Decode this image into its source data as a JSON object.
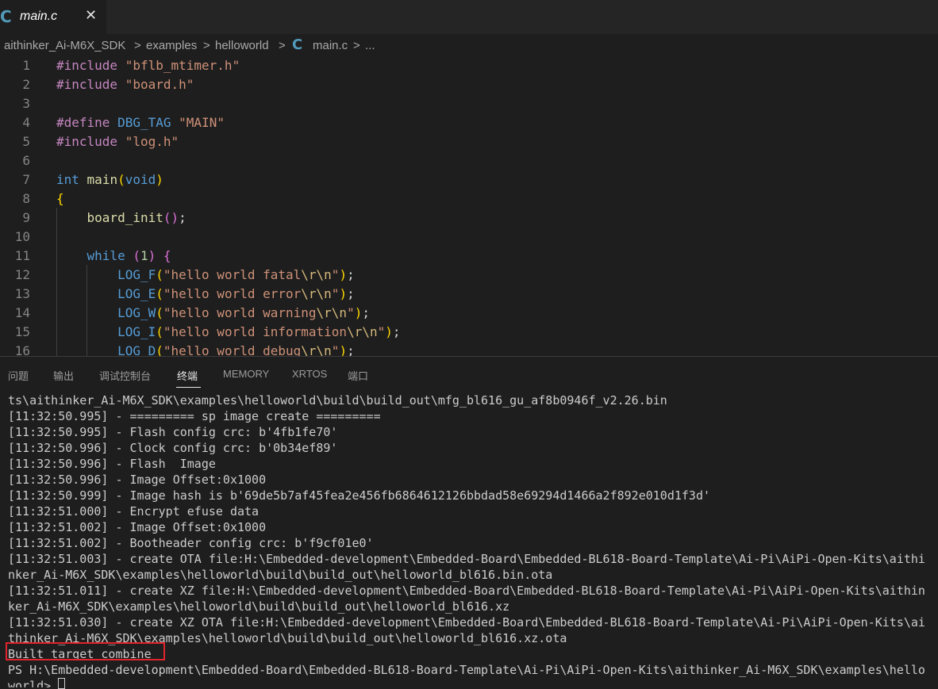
{
  "editor_tab": {
    "icon": "C",
    "label": "main.c",
    "close": "✕"
  },
  "breadcrumb": {
    "items": [
      "aithinker_Ai-M6X_SDK",
      "examples",
      "helloworld",
      "main.c",
      "..."
    ],
    "separator": ">"
  },
  "code": {
    "line_numbers": [
      "1",
      "2",
      "3",
      "4",
      "5",
      "6",
      "7",
      "8",
      "9",
      "10",
      "11",
      "12",
      "13",
      "14",
      "15",
      "16"
    ],
    "lines": [
      "#include \"bflb_mtimer.h\"",
      "#include \"board.h\"",
      "",
      "#define DBG_TAG \"MAIN\"",
      "#include \"log.h\"",
      "",
      "int main(void)",
      "{",
      "    board_init();",
      "",
      "    while (1) {",
      "        LOG_F(\"hello world fatal\\r\\n\");",
      "        LOG_E(\"hello world error\\r\\n\");",
      "        LOG_W(\"hello world warning\\r\\n\");",
      "        LOG_I(\"hello world information\\r\\n\");",
      "        LOG_D(\"hello world debug\\r\\n\");"
    ]
  },
  "panel": {
    "tabs": [
      "问题",
      "输出",
      "调试控制台",
      "终端",
      "MEMORY",
      "XRTOS",
      "端口"
    ],
    "active_tab": "终端"
  },
  "terminal": {
    "lines": [
      "ts\\aithinker_Ai-M6X_SDK\\examples\\helloworld\\build\\build_out\\mfg_bl616_gu_af8b0946f_v2.26.bin",
      "[11:32:50.995] - ========= sp image create =========",
      "[11:32:50.995] - Flash config crc: b'4fb1fe70'",
      "[11:32:50.996] - Clock config crc: b'0b34ef89'",
      "[11:32:50.996] - Flash  Image",
      "[11:32:50.996] - Image Offset:0x1000",
      "[11:32:50.999] - Image hash is b'69de5b7af45fea2e456fb6864612126bbdad58e69294d1466a2f892e010d1f3d'",
      "[11:32:51.000] - Encrypt efuse data",
      "[11:32:51.002] - Image Offset:0x1000",
      "[11:32:51.002] - Bootheader config crc: b'f9cf01e0'",
      "[11:32:51.003] - create OTA file:H:\\Embedded-development\\Embedded-Board\\Embedded-BL618-Board-Template\\Ai-Pi\\AiPi-Open-Kits\\aithi",
      "nker_Ai-M6X_SDK\\examples\\helloworld\\build\\build_out\\helloworld_bl616.bin.ota",
      "[11:32:51.011] - create XZ file:H:\\Embedded-development\\Embedded-Board\\Embedded-BL618-Board-Template\\Ai-Pi\\AiPi-Open-Kits\\aithin",
      "ker_Ai-M6X_SDK\\examples\\helloworld\\build\\build_out\\helloworld_bl616.xz",
      "[11:32:51.030] - create XZ OTA file:H:\\Embedded-development\\Embedded-Board\\Embedded-BL618-Board-Template\\Ai-Pi\\AiPi-Open-Kits\\ai",
      "thinker_Ai-M6X_SDK\\examples\\helloworld\\build\\build_out\\helloworld_bl616.xz.ota",
      "Built target combine",
      "PS H:\\Embedded-development\\Embedded-Board\\Embedded-BL618-Board-Template\\Ai-Pi\\AiPi-Open-Kits\\aithinker_Ai-M6X_SDK\\examples\\hello",
      "world> "
    ]
  },
  "colors": {
    "keyword": "#c586c0",
    "string": "#ce9178",
    "type": "#569cd6",
    "function": "#dcdcaa",
    "highlight_border": "#e0242b",
    "c_file_icon": "#519aba"
  }
}
